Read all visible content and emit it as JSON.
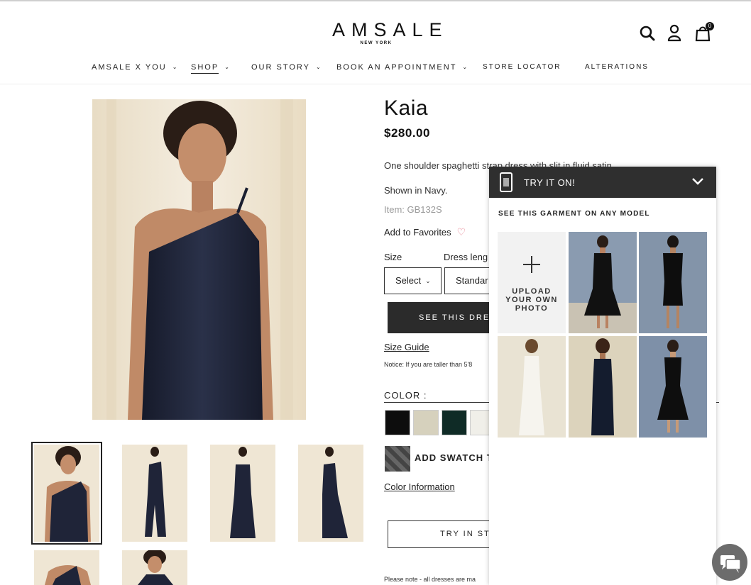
{
  "brand": {
    "logo": "AMSALE",
    "logo_sub": "NEW YORK"
  },
  "header": {
    "icons": [
      "search-icon",
      "account-icon",
      "cart-icon"
    ],
    "cart_count": "0"
  },
  "nav": {
    "items": [
      {
        "label": "AMSALE X YOU",
        "dropdown": true
      },
      {
        "label": "SHOP",
        "dropdown": true,
        "active": true
      },
      {
        "label": "OUR STORY",
        "dropdown": true
      },
      {
        "label": "BOOK AN APPOINTMENT",
        "dropdown": true
      },
      {
        "label": "STORE LOCATOR",
        "dropdown": false
      },
      {
        "label": "ALTERATIONS",
        "dropdown": false
      }
    ]
  },
  "product": {
    "title": "Kaia",
    "price": "$280.00",
    "description": "One shoulder spaghetti strap dress with slit in fluid satin.",
    "shown_in": "Shown in Navy.",
    "item": "Item: GB132S",
    "add_favorites": "Add to Favorites",
    "size_label": "Size",
    "dress_length_label": "Dress leng",
    "size_select": "Select",
    "length_select": "Standar",
    "see_dress_button": "SEE THIS DRESS O",
    "size_guide": "Size Guide",
    "notice": "Notice: If you are taller than 5'8",
    "color_label": "COLOR :",
    "swatches": [
      "#0d0d0d",
      "#d6d1bd",
      "#0f2b26",
      "#f0efe9"
    ],
    "add_swatch": "ADD SWATCH TO",
    "color_info": "Color Information",
    "try_in_store": "TRY IN STOR",
    "please_note": "Please note - all dresses are ma"
  },
  "tryon": {
    "title": "TRY IT ON!",
    "subtitle": "SEE THIS GARMENT ON ANY MODEL",
    "upload_line1": "UPLOAD",
    "upload_line2": "YOUR OWN",
    "upload_line3": "PHOTO"
  },
  "colors": {
    "accent_dark": "#2f2f2f",
    "dress_navy": "#1d2236",
    "backdrop_cream": "#efe6d4"
  }
}
